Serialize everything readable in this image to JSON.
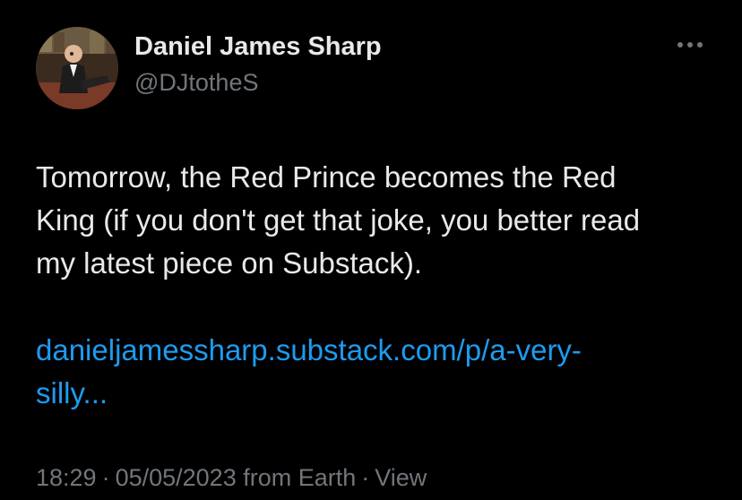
{
  "author": {
    "display_name": "Daniel James Sharp",
    "handle": "@DJtotheS"
  },
  "more_icon": "more-horizontal-icon",
  "tweet": {
    "text_lines": [
      "Tomorrow, the Red Prince becomes the Red",
      "King (if you don't get that joke, you better read",
      "my latest piece on Substack)."
    ],
    "link_lines": [
      "danieljamessharp.substack.com/p/a-very-",
      "silly..."
    ]
  },
  "meta": {
    "time": "18:29",
    "separator": "·",
    "date": "05/05/2023 from Earth",
    "view_label": "View"
  },
  "colors": {
    "background": "#000000",
    "primary_text": "#e7e9ea",
    "secondary_text": "#71767b",
    "link": "#1d9bf0"
  }
}
